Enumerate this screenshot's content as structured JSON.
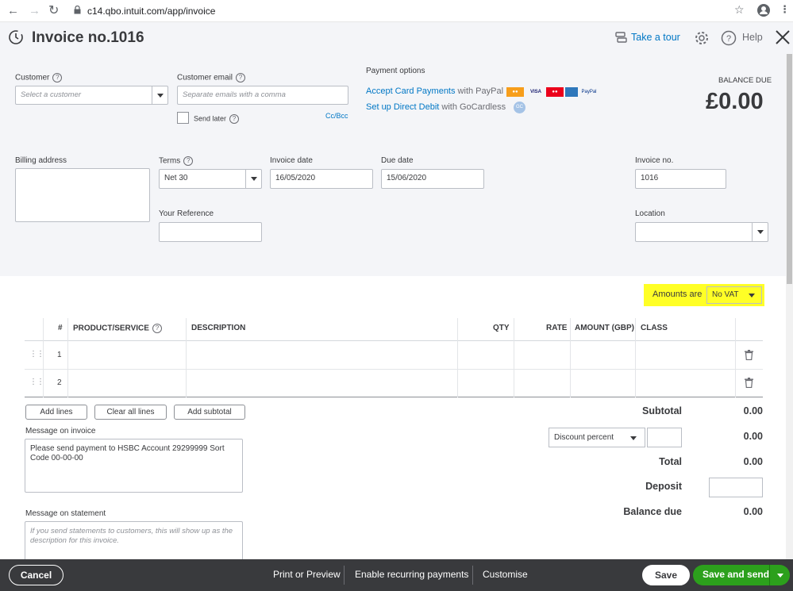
{
  "browser": {
    "url": "c14.qbo.intuit.com/app/invoice"
  },
  "header": {
    "title": "Invoice no.1016",
    "tour_label": "Take a tour",
    "help_label": "Help"
  },
  "customer": {
    "label": "Customer",
    "placeholder": "Select a customer"
  },
  "email": {
    "label": "Customer email",
    "placeholder": "Separate emails with a comma",
    "send_later": "Send later",
    "cc_bcc": "Cc/Bcc"
  },
  "payment": {
    "title": "Payment options",
    "card_link": "Accept Card Payments",
    "card_suffix": " with PayPal",
    "dd_link": "Set up Direct Debit",
    "dd_suffix": " with GoCardless",
    "card_labels": [
      "VISA",
      "PayPal"
    ]
  },
  "balance": {
    "label": "BALANCE DUE",
    "value": "£0.00"
  },
  "billing": {
    "label": "Billing address"
  },
  "terms": {
    "label": "Terms",
    "value": "Net 30"
  },
  "invoice_date": {
    "label": "Invoice date",
    "value": "16/05/2020"
  },
  "due_date": {
    "label": "Due date",
    "value": "15/06/2020"
  },
  "invoice_no": {
    "label": "Invoice no.",
    "value": "1016"
  },
  "your_ref": {
    "label": "Your Reference"
  },
  "location": {
    "label": "Location"
  },
  "amounts": {
    "label": "Amounts are",
    "value": "No VAT",
    "highlight": "#ffff00"
  },
  "table": {
    "headers": {
      "num": "#",
      "product": "PRODUCT/SERVICE",
      "description": "DESCRIPTION",
      "qty": "QTY",
      "rate": "RATE",
      "amount": "AMOUNT (GBP)",
      "class": "CLASS"
    },
    "rows": [
      {
        "num": "1"
      },
      {
        "num": "2"
      }
    ]
  },
  "buttons": {
    "add_lines": "Add lines",
    "clear_all": "Clear all lines",
    "add_subtotal": "Add subtotal"
  },
  "message_invoice": {
    "label": "Message on invoice",
    "value": "Please send payment to HSBC Account 29299999 Sort Code 00-00-00"
  },
  "message_statement": {
    "label": "Message on statement",
    "placeholder": "If you send statements to customers, this will show up as the description for this invoice."
  },
  "totals": {
    "subtotal_label": "Subtotal",
    "subtotal": "0.00",
    "discount_type": "Discount percent",
    "discount": "0.00",
    "total_label": "Total",
    "total": "0.00",
    "deposit_label": "Deposit",
    "balance_label": "Balance due",
    "balance": "0.00"
  },
  "footer": {
    "cancel": "Cancel",
    "print": "Print or Preview",
    "recurring": "Enable recurring payments",
    "customise": "Customise",
    "save": "Save",
    "save_send": "Save and send"
  },
  "colors": {
    "accent": "#0077c5",
    "primary_green": "#2ca01c",
    "footer_bg": "#393a3d"
  }
}
